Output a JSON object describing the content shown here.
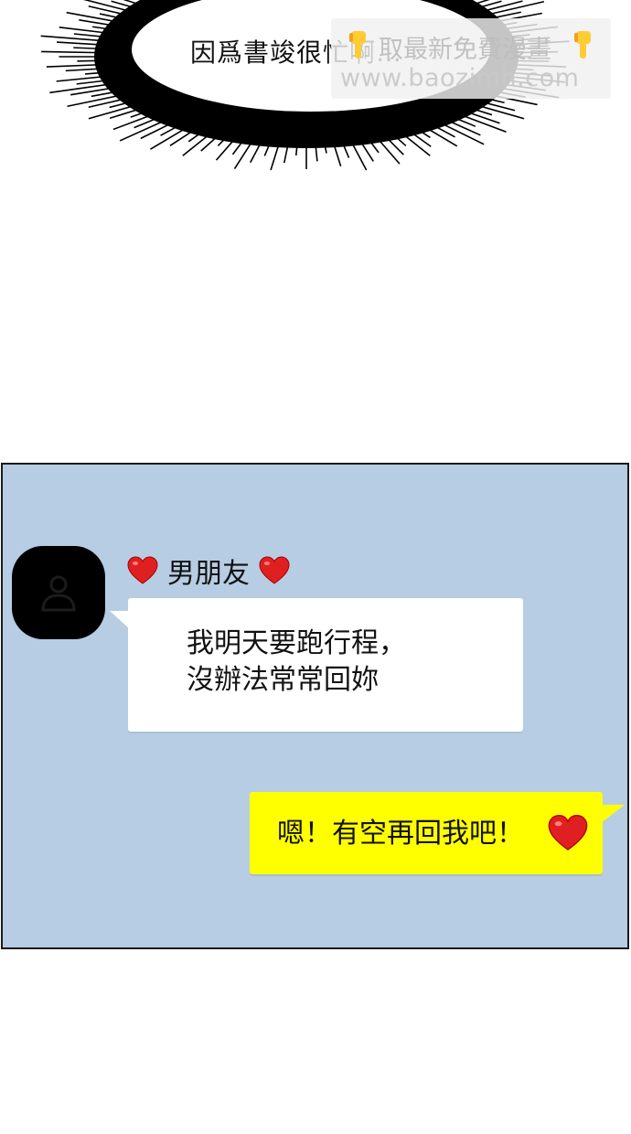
{
  "speech_burst": {
    "text": "因爲書竣很忙啊…"
  },
  "watermark": {
    "line1": "取最新免費漫畫",
    "line2": "www.baozimh.com",
    "left_icon": "pointing-down-hand-icon",
    "right_icon": "pointing-down-hand-icon"
  },
  "chat": {
    "background_color": "#b6cde3",
    "contact": {
      "name": "男朋友",
      "avatar_icon": "person-silhouette-icon",
      "name_decoration_icon": "red-heart-icon"
    },
    "incoming_message": {
      "line1": "我明天要跑行程，",
      "line2": "沒辦法常常回妳"
    },
    "outgoing_message": {
      "text": "嗯！有空再回我吧！",
      "emoji": "red-heart-icon",
      "bubble_color": "#ffff00"
    }
  }
}
